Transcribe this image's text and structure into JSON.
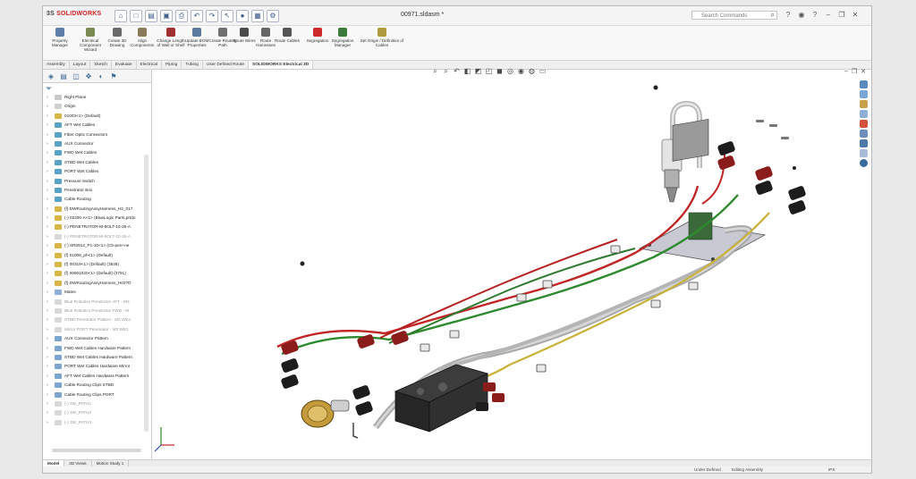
{
  "app": {
    "logo_main": "SOLIDWORKS",
    "title": "00971.sldasm *"
  },
  "search": {
    "placeholder": "Search Commands"
  },
  "ribbon": [
    {
      "label": "Property Manager",
      "color": "#5d7ea8"
    },
    {
      "label": "Electrical Component Wizard",
      "color": "#7a8a52"
    },
    {
      "label": "Create 3D Drawing",
      "color": "#6a6a6a"
    },
    {
      "label": "Align Components",
      "color": "#8a7a5a"
    },
    {
      "label": "Change Length of Wall or Shelf",
      "color": "#a03030"
    },
    {
      "label": "Update BOM Properties",
      "color": "#5a7aa0"
    },
    {
      "label": "Create Routing Path",
      "color": "#707070"
    },
    {
      "label": "Route Wires",
      "color": "#4a4a4a"
    },
    {
      "label": "Route Harnesses",
      "color": "#666666"
    },
    {
      "label": "Route Cables",
      "color": "#555555"
    },
    {
      "label": "Segregation",
      "color": "#cc2a2a"
    },
    {
      "label": "Segregation Manager",
      "color": "#3a7a3a"
    },
    {
      "label": "Set Origin / Definition of Cables",
      "color": "#b09a40"
    }
  ],
  "tabs": [
    "Assembly",
    "Layout",
    "Sketch",
    "Evaluate",
    "Electrical",
    "Piping",
    "Tubing",
    "User Defined Route",
    "SOLIDWORKS Electrical 3D"
  ],
  "tree": [
    {
      "label": "Right Plane",
      "color": "#c9c9c9"
    },
    {
      "label": "Origin",
      "color": "#d0d0d0"
    },
    {
      "label": "01003<1> (Default)",
      "color": "#d8b64a"
    },
    {
      "label": "AFT Wet Cables",
      "color": "#5ba3c4"
    },
    {
      "label": "Fiber Optic Connectors",
      "color": "#5ba3c4"
    },
    {
      "label": "AUX Connector",
      "color": "#5ba3c4"
    },
    {
      "label": "FWD Wet Cables",
      "color": "#5ba3c4"
    },
    {
      "label": "STBD Wet Cables",
      "color": "#5ba3c4"
    },
    {
      "label": "PORT Wet Cables",
      "color": "#5ba3c4"
    },
    {
      "label": "Pressure Switch",
      "color": "#5ba3c4"
    },
    {
      "label": "Penetrator Box",
      "color": "#5ba3c4"
    },
    {
      "label": "Cable Routing",
      "color": "#5ba3c4"
    },
    {
      "label": "(f) DWRoutingAssyHarness_H2_01?",
      "color": "#d8b64a"
    },
    {
      "label": "(-) 02200-A<1> (BlueLogic Parts,prtdo",
      "color": "#d8b64a"
    },
    {
      "label": "(-) PENETRATOR-M-8OLT-10-25-A",
      "color": "#d8b64a"
    },
    {
      "label": "(-) PENETRATOR-M-8OLT-10-25-A",
      "color": "#d8d8d8",
      "grey": true
    },
    {
      "label": "(-) SR0912_P1-10<1> (Cb-pen+ne",
      "color": "#d8b64a"
    },
    {
      "label": "(f) 01008_ph<1> (Default)",
      "color": "#d8b64a"
    },
    {
      "label": "(f) 00319<1> (Default) (3548)",
      "color": "#d8b64a"
    },
    {
      "label": "(f) 00601020<1> (Default) (3791)",
      "color": "#d8b64a"
    },
    {
      "label": "(f) DWRoutingAssyHarness_H03?D",
      "color": "#d8b64a"
    },
    {
      "label": "Mates",
      "color": "#8fb0d6"
    },
    {
      "label": "Blue Robotics Penetrator AFT - M3",
      "color": "#d8d8d8",
      "grey": true
    },
    {
      "label": "Blue Robotics Penetrator FWD - M",
      "color": "#d8d8d8",
      "grey": true
    },
    {
      "label": "STBD Penetrator Pattern - M3 WE1",
      "color": "#d8d8d8",
      "grey": true
    },
    {
      "label": "Mirror PORT Penetrator - M3 WE1",
      "color": "#d8d8d8",
      "grey": true
    },
    {
      "label": "AUX Connector Pattern",
      "color": "#7da6cf"
    },
    {
      "label": "FWD Wet Cables Hardware Pattern",
      "color": "#7da6cf"
    },
    {
      "label": "STBD Wet Cables Hardware Pattern",
      "color": "#7da6cf"
    },
    {
      "label": "PORT Wet Cables Hardware Mirror",
      "color": "#7da6cf"
    },
    {
      "label": "AFT Wet Cables Hardware Pattern",
      "color": "#7da6cf"
    },
    {
      "label": "Cable Routing Clips STBD",
      "color": "#7da6cf"
    },
    {
      "label": "Cable Routing Clips PORT",
      "color": "#7da6cf"
    },
    {
      "label": "(-) 3W_PATH1",
      "color": "#d8d8d8",
      "grey": true
    },
    {
      "label": "(-) 3W_PATH2",
      "color": "#d8d8d8",
      "grey": true
    },
    {
      "label": "(-) 3W_PATH3",
      "color": "#d8d8d8",
      "grey": true
    }
  ],
  "bottom_tabs": [
    "Model",
    "3D Views",
    "Motion Study 1"
  ],
  "status": {
    "defined": "Under Defined",
    "editing": "Editing Assembly",
    "units": "IPS"
  }
}
